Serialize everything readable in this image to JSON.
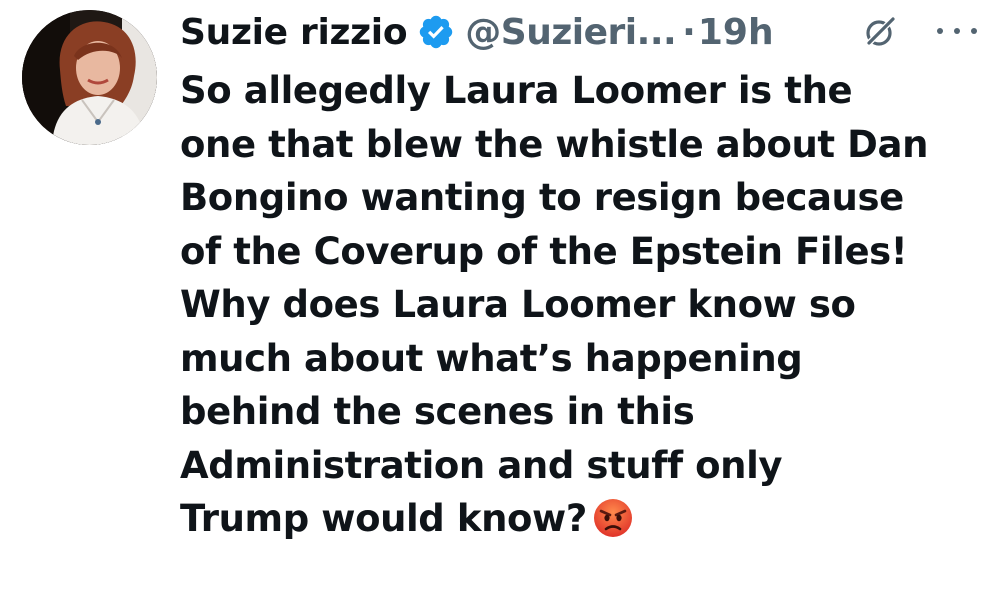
{
  "author": {
    "display_name": "Suzie rizzio",
    "handle": "@Suzieri...",
    "separator": "·",
    "time": "19h",
    "verified": true,
    "avatar_icon": "profile-photo"
  },
  "icons": {
    "verified": "verified-badge-icon",
    "grok": "grok-icon",
    "more": "more-options-icon",
    "emoji": "angry-face-emoji"
  },
  "colors": {
    "text": "#0f1419",
    "secondary": "#536471",
    "verified_blue": "#1d9bf0"
  },
  "tweet": {
    "lines": [
      "So allegedly Laura Loomer is the",
      "one that blew the whistle about Dan",
      "Bongino wanting to resign because",
      "of the Coverup of the Epstein Files!",
      "Why does Laura Loomer know so",
      "much about what’s happening",
      "behind the scenes in this",
      "Administration and stuff only",
      "Trump would know?"
    ],
    "trailing_emoji": "😡"
  }
}
